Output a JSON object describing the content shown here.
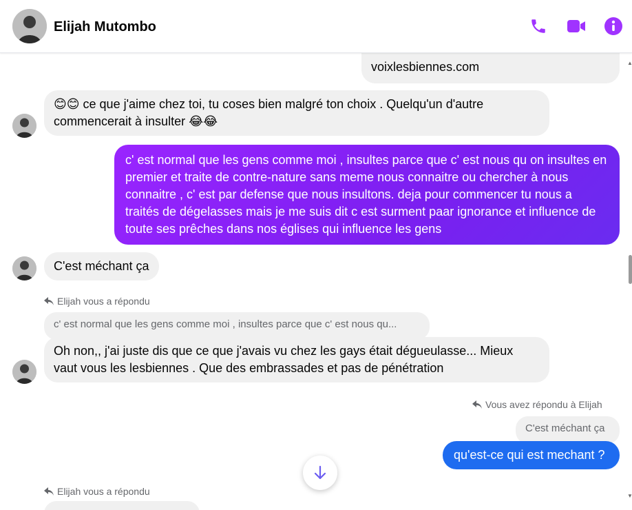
{
  "header": {
    "contact_name": "Elijah Mutombo",
    "icons": {
      "call": "phone-icon",
      "video": "video-icon",
      "info": "info-icon"
    },
    "accent_color": "#a033ff"
  },
  "messages": {
    "m0_text": "voixlesbiennes.com",
    "m1_text": "😊😊 ce que j'aime chez toi, tu coses bien malgré ton choix . Quelqu'un d'autre commencerait à insulter 😂😂",
    "m2_text": "c' est normal que les gens comme moi , insultes parce que c' est nous qu on insultes en premier et traite de contre-nature sans meme nous connaitre ou chercher à nous connaitre , c' est par defense que nous insultons. deja pour commencer tu nous a traités de dégelasses mais je me suis dit c est surment paar ignorance et influence de toute ses prêches dans nos églises qui influence les gens",
    "m3_text": "C'est méchant ça",
    "m4_reply_label": "Elijah vous a répondu",
    "m4_quote": "c' est normal que les gens comme moi , insultes parce que c' est nous qu...",
    "m4_text": "Oh non,, j'ai juste dis que ce que j'avais vu chez les gays était dégueulasse... Mieux vaut vous les lesbiennes . Que des embrassades et pas de pénétration",
    "m5_reply_label": "Vous avez répondu à Elijah",
    "m5_quote": "C'est méchant ça",
    "m5_text": "qu'est-ce qui est mechant ?",
    "m6_reply_label": "Elijah vous a répondu"
  },
  "colors": {
    "incoming_bubble": "#f0f0f0",
    "outgoing_gradient_start": "#9a25ff",
    "outgoing_blue": "#1e6cf0",
    "secondary_text": "#65676b"
  }
}
